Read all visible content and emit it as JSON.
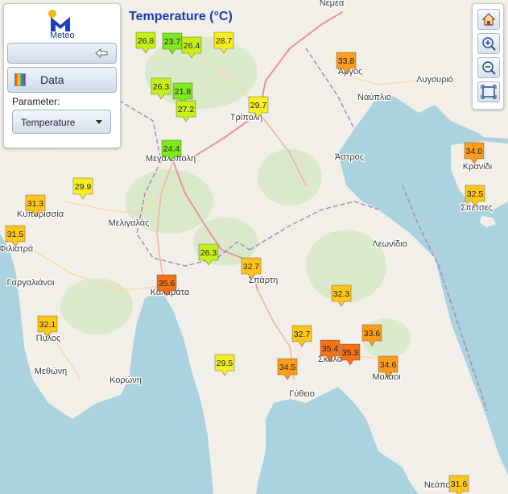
{
  "title": "Temperature (°C)",
  "logo": {
    "text": "Meteo"
  },
  "panel": {
    "data_label": "Data",
    "parameter_label": "Parameter:",
    "parameter_value": "Temperature"
  },
  "toolbar": [
    "home-icon",
    "zoom-in-icon",
    "zoom-out-icon",
    "full-extent-icon"
  ],
  "colors": {
    "green": "#7fe81e",
    "lime": "#c7f01a",
    "yellow": "#f6ee22",
    "gold": "#ffc61a",
    "orange": "#ff9d1a",
    "dark_orange": "#f47316",
    "title": "#1b3cb0"
  },
  "places": [
    {
      "name": "Νεμέα"
    },
    {
      "name": "Άργος"
    },
    {
      "name": "Λυγουριό"
    },
    {
      "name": "Ναύπλιο"
    },
    {
      "name": "Τρίπολη"
    },
    {
      "name": "Άστρος"
    },
    {
      "name": "Μεγαλόπολη"
    },
    {
      "name": "Κρανίδι"
    },
    {
      "name": "Σπέτσες"
    },
    {
      "name": "Κυπαρισσία"
    },
    {
      "name": "Φιλιατρά"
    },
    {
      "name": "Μελιγαλάς"
    },
    {
      "name": "Λεωνίδιο"
    },
    {
      "name": "Γαργαλιάνοι"
    },
    {
      "name": "Καλαμάτα"
    },
    {
      "name": "Σπάρτη"
    },
    {
      "name": "Πύλος"
    },
    {
      "name": "Μεθώνη"
    },
    {
      "name": "Κορώνη"
    },
    {
      "name": "Σκάλα"
    },
    {
      "name": "Μολάοι"
    },
    {
      "name": "Γύθειο"
    },
    {
      "name": "Νεάπολη"
    }
  ],
  "stations": [
    {
      "value": "26.8",
      "color": "lime"
    },
    {
      "value": "23.7",
      "color": "green"
    },
    {
      "value": "26.4",
      "color": "lime"
    },
    {
      "value": "28.7",
      "color": "yellow"
    },
    {
      "value": "33.8",
      "color": "orange"
    },
    {
      "value": "26.3",
      "color": "lime"
    },
    {
      "value": "21.8",
      "color": "green"
    },
    {
      "value": "27.2",
      "color": "lime"
    },
    {
      "value": "29.7",
      "color": "yellow"
    },
    {
      "value": "24.4",
      "color": "green"
    },
    {
      "value": "34.0",
      "color": "orange"
    },
    {
      "value": "29.9",
      "color": "yellow"
    },
    {
      "value": "31.3",
      "color": "gold"
    },
    {
      "value": "32.5",
      "color": "gold"
    },
    {
      "value": "31.5",
      "color": "gold"
    },
    {
      "value": "26.3",
      "color": "lime"
    },
    {
      "value": "32.7",
      "color": "gold"
    },
    {
      "value": "35.6",
      "color": "dark_orange"
    },
    {
      "value": "32.3",
      "color": "gold"
    },
    {
      "value": "32.1",
      "color": "gold"
    },
    {
      "value": "32.7",
      "color": "gold"
    },
    {
      "value": "33.6",
      "color": "orange"
    },
    {
      "value": "35.4",
      "color": "dark_orange"
    },
    {
      "value": "35.3",
      "color": "dark_orange"
    },
    {
      "value": "29.5",
      "color": "yellow"
    },
    {
      "value": "34.5",
      "color": "orange"
    },
    {
      "value": "34.6",
      "color": "orange"
    },
    {
      "value": "31.6",
      "color": "gold"
    }
  ]
}
